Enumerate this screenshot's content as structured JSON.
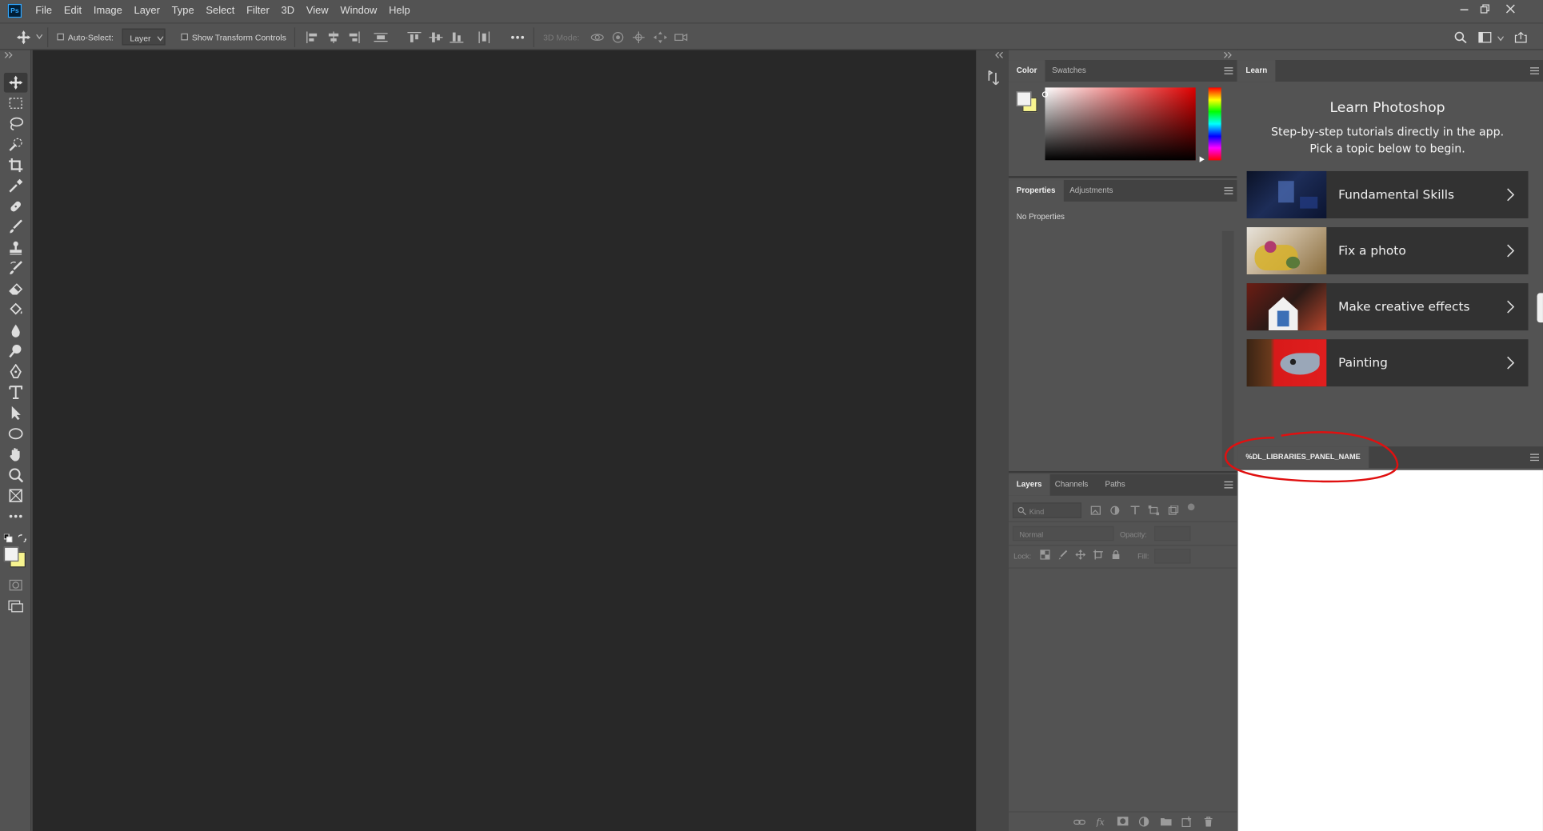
{
  "app": {
    "logo_text": "Ps",
    "menu": [
      "File",
      "Edit",
      "Image",
      "Layer",
      "Type",
      "Select",
      "Filter",
      "3D",
      "View",
      "Window",
      "Help"
    ]
  },
  "options_bar": {
    "auto_select_label": "Auto-Select:",
    "auto_select_target": "Layer",
    "show_transform_label": "Show Transform Controls",
    "mode_3d_label": "3D Mode:"
  },
  "color_panel": {
    "tabs": [
      "Color",
      "Swatches"
    ],
    "foreground": "#f2f2f2",
    "background": "#f7f48f",
    "picker_hue": "#e00000"
  },
  "properties_panel": {
    "tabs": [
      "Properties",
      "Adjustments"
    ],
    "empty_text": "No Properties"
  },
  "layers_panel": {
    "tabs": [
      "Layers",
      "Channels",
      "Paths"
    ],
    "filter_placeholder": "Kind",
    "blend_mode": "Normal",
    "opacity_label": "Opacity:",
    "lock_label": "Lock:",
    "fill_label": "Fill:"
  },
  "learn_panel": {
    "tab": "Learn",
    "title": "Learn Photoshop",
    "subtitle": "Step-by-step tutorials directly in the app. Pick a topic below to begin.",
    "topics": [
      {
        "label": "Fundamental Skills"
      },
      {
        "label": "Fix a photo"
      },
      {
        "label": "Make creative effects"
      },
      {
        "label": "Painting"
      }
    ]
  },
  "libraries_panel": {
    "tab": "%DL_LIBRARIES_PANEL_NAME"
  },
  "colors": {
    "annotation_circle": "#e01010"
  }
}
